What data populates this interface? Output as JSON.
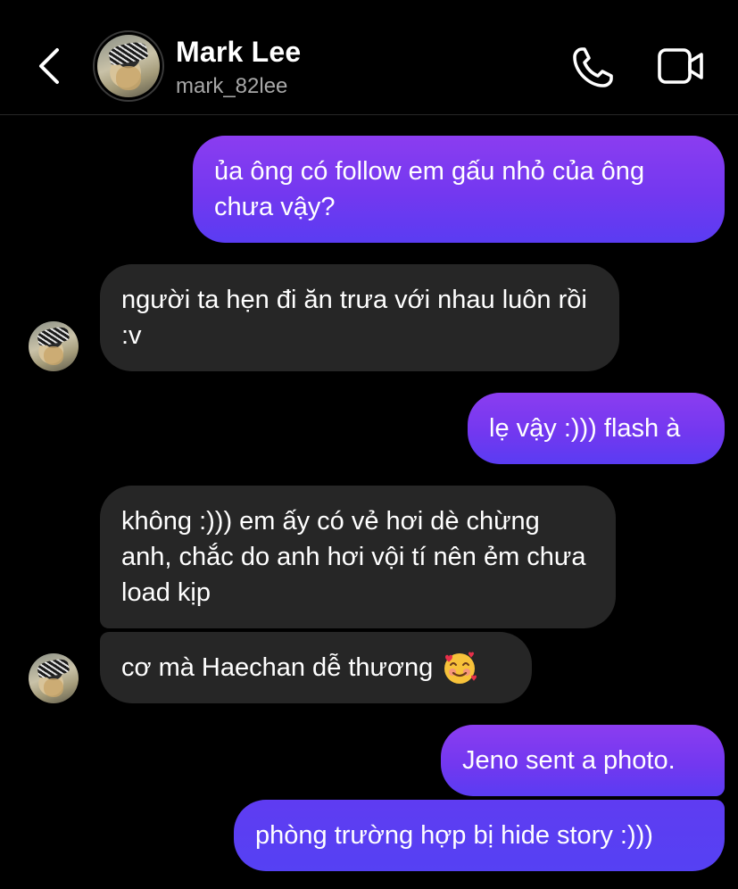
{
  "header": {
    "name": "Mark Lee",
    "handle": "mark_82lee",
    "icons": {
      "back": "chevron-left-icon",
      "call": "phone-icon",
      "video": "video-camera-icon"
    }
  },
  "messages": [
    {
      "direction": "sent",
      "text": "ủa ông có follow em gấu nhỏ của ông chưa vậy?"
    },
    {
      "direction": "received",
      "text": "người ta hẹn đi ăn trưa với nhau luôn rồi :v"
    },
    {
      "direction": "sent",
      "text": "lẹ vậy :))) flash à"
    },
    {
      "direction": "received",
      "text": "không :))) em ấy có vẻ hơi dè chừng anh, chắc do anh hơi vội tí nên ẻm chưa load kịp"
    },
    {
      "direction": "received",
      "text": "cơ mà Haechan dễ thương",
      "emoji": "smiling-face-with-hearts"
    },
    {
      "direction": "sent",
      "text": "Jeno sent a photo."
    },
    {
      "direction": "sent",
      "text": "phòng trường hợp bị hide story :)))"
    }
  ],
  "colors": {
    "background": "#000000",
    "sent_bubble_top": "#8b3df0",
    "sent_bubble_bottom": "#5a3cf2",
    "received_bubble": "#262626",
    "secondary_text": "#a8a8a8"
  }
}
